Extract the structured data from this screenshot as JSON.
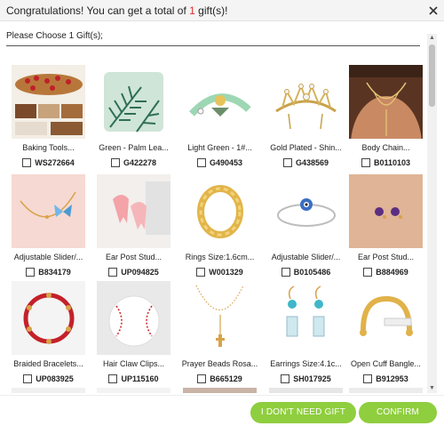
{
  "header": {
    "prefix": "Congratulations! You can get a total of ",
    "count": "1",
    "suffix": " gift(s)!"
  },
  "subheading": "Please Choose 1 Gift(s);",
  "gifts": [
    {
      "title": "Baking Tools...",
      "sku": "WS272664",
      "icon": "baking-tools-image"
    },
    {
      "title": "Green - Palm Lea...",
      "sku": "G422278",
      "icon": "palm-leaf-pillow-image"
    },
    {
      "title": "Light Green - 1#...",
      "sku": "G490453",
      "icon": "pet-collar-image"
    },
    {
      "title": "Gold Plated - Shin...",
      "sku": "G438569",
      "icon": "tiara-image"
    },
    {
      "title": "Body Chain...",
      "sku": "B0110103",
      "icon": "body-chain-image"
    },
    {
      "title": "Adjustable Slider/...",
      "sku": "B834179",
      "icon": "butterfly-bracelet-image"
    },
    {
      "title": "Ear Post Stud...",
      "sku": "UP094825",
      "icon": "tooth-earrings-image"
    },
    {
      "title": "Rings Size:1.6cm...",
      "sku": "W001329",
      "icon": "gold-ring-image"
    },
    {
      "title": "Adjustable Slider/...",
      "sku": "B0105486",
      "icon": "hamsa-bracelet-image"
    },
    {
      "title": "Ear Post Stud...",
      "sku": "B884969",
      "icon": "stud-earrings-image"
    },
    {
      "title": "Braided Bracelets...",
      "sku": "UP083925",
      "icon": "braided-bracelet-image"
    },
    {
      "title": "Hair Claw Clips...",
      "sku": "UP115160",
      "icon": "baseball-clip-image"
    },
    {
      "title": "Prayer Beads Rosa...",
      "sku": "B665129",
      "icon": "rosary-necklace-image"
    },
    {
      "title": "Earrings Size:4.1c...",
      "sku": "SH017925",
      "icon": "drop-earrings-image"
    },
    {
      "title": "Open Cuff Bangle...",
      "sku": "B912953",
      "icon": "cuff-bangle-image"
    }
  ],
  "buttons": {
    "decline": "I DON'T NEED GIFT",
    "confirm": "CONFIRM"
  },
  "colors": {
    "accent_green": "#8fce3e",
    "count_red": "#e02c2c"
  }
}
